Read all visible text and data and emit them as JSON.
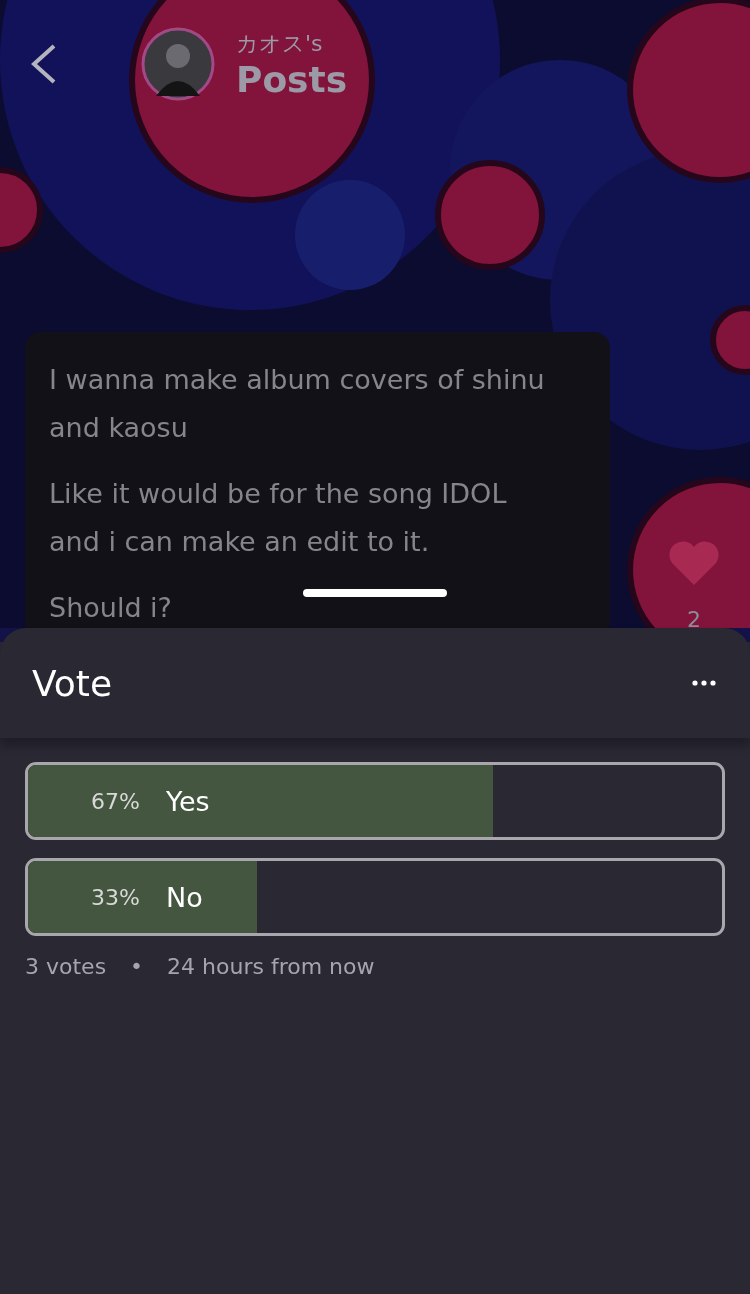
{
  "header": {
    "owner": "カオス's",
    "title": "Posts"
  },
  "post": {
    "paragraphs": [
      "I wanna make album covers of shinu and kaosu",
      "Like it would be for the song IDOL and i can make an edit to it.",
      "Should i?"
    ],
    "likes": "2"
  },
  "poll": {
    "title": "Vote",
    "options": [
      {
        "percent": "67%",
        "label": "Yes",
        "level": 0.67
      },
      {
        "percent": "33%",
        "label": "No",
        "level": 0.33
      }
    ],
    "votes": "3 votes",
    "separator": "•",
    "ends": "24 hours from now"
  }
}
